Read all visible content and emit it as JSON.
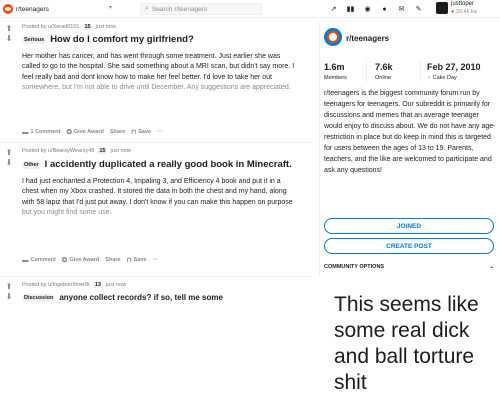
{
  "header": {
    "community": "r/teenagers",
    "search_placeholder": "Search r/teenagers",
    "icons": [
      "trending-icon",
      "stats-icon",
      "coins-icon",
      "chat-icon",
      "mail-icon",
      "edit-icon"
    ],
    "username": "justtoper",
    "karma": "33.4k ka"
  },
  "posts": [
    {
      "score": "",
      "meta": "Posted by u/Xerad0101",
      "badge": "15",
      "time": "just now",
      "flair": "Serious",
      "title": "How do I comfort my girlfriend?",
      "body": [
        "Her mother has cancer, and has went through some treatment. Just earlier she was",
        "called to go to the hospital. She said something about a MRI scan, but didn't say more. I",
        "feel really bad and dont know how to make her feel better. I'd love to take her out",
        "somewhere, but I'm not able to drive until December. Any suggestions are appreciated."
      ],
      "actions": [
        "1 Comment",
        "Give Award",
        "Share",
        "Save",
        "···"
      ]
    },
    {
      "meta": "Posted by u/BearsyWearsy48",
      "badge": "15",
      "time": "just now",
      "flair": "Other",
      "title": "I accidently duplicated a really good book in Minecraft.",
      "body": [
        "I had just enchanted a Protection 4, Impaling 3, and Efficiency 4 book and put it in a",
        "chest when my Xbox crashed. It stored the data in both the chest and my hand, along",
        "with 58 lapiz that I'd just put away. I don't know if you can make this happen on purpose",
        "but you might find some use."
      ],
      "actions": [
        "Comment",
        "Give Award",
        "Share",
        "Save",
        "···"
      ]
    },
    {
      "meta": "Posted by u/Ingebior9mer8r",
      "badge": "13",
      "time": "just now",
      "flair": "Discussion",
      "title": "anyone collect records? if so, tell me some"
    }
  ],
  "sidebar": {
    "name": "r/teenagers",
    "stats": [
      {
        "value": "1.6m",
        "label": "Members"
      },
      {
        "value": "7.6k",
        "label": "Online"
      },
      {
        "value": "Feb 27, 2010",
        "label": "Cake Day"
      }
    ],
    "description": "r/teenagers is the biggest community forum run by teenagers for teenagers. Our subreddit is primarily for discussions and memes that an average teenager would enjoy to discuss about. We do not have any age-restriction in place but do keep in mind this is targeted for users between the ages of 13 to 19. Parents, teachers, and the like are welcomed to participate and ask any questions!",
    "joined_label": "JOINED",
    "create_label": "CREATE POST",
    "options_label": "COMMUNITY OPTIONS"
  },
  "caption": "This seems like some real dick and ball torture shit",
  "colors": {
    "accent": "#0079d3",
    "orange": "#ff4500",
    "text": "#1c1c1c",
    "muted": "#878a8c"
  }
}
